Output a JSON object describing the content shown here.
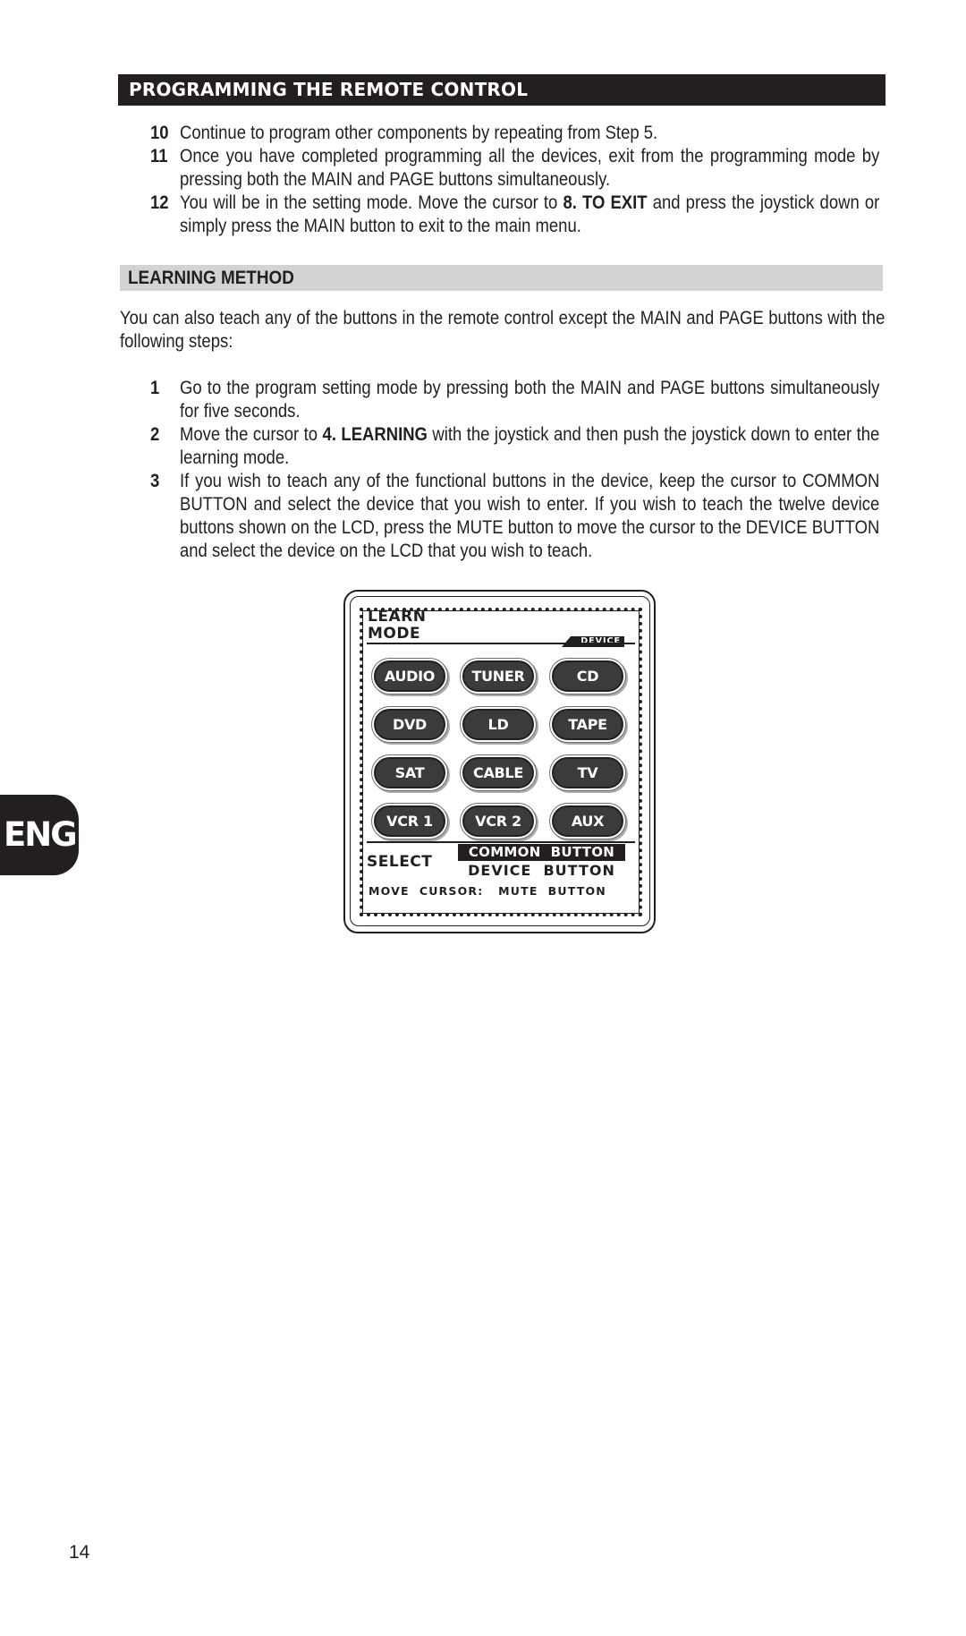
{
  "section": {
    "title": "PROGRAMMING THE REMOTE CONTROL",
    "steps": [
      {
        "num": "10",
        "text": "Continue to program other components by repeating from Step 5."
      },
      {
        "num": "11",
        "text": "Once you have completed programming all the devices, exit from the programming mode by pressing both the MAIN and PAGE buttons simultaneously."
      },
      {
        "num": "12",
        "text_before": "You will be in the setting mode. Move the cursor to ",
        "bold": "8. TO EXIT",
        "text_after": " and press the joystick down or simply press the MAIN button to exit to the main menu."
      }
    ]
  },
  "learning": {
    "title": "LEARNING METHOD",
    "intro": "You can also teach any of the buttons in the remote control except the MAIN and PAGE buttons with the following steps:",
    "steps": [
      {
        "num": "1",
        "text": "Go to the program setting mode by pressing both the MAIN and PAGE buttons simultaneously for five seconds."
      },
      {
        "num": "2",
        "text_before": "Move the cursor to ",
        "bold": "4. LEARNING",
        "text_after": " with the joystick and then push the joystick down to enter the learning mode."
      },
      {
        "num": "3",
        "text": "If you wish to teach any of the functional buttons in the device, keep the cursor to COMMON BUTTON and select the device that you wish to enter. If you wish to teach the twelve device buttons shown on the LCD, press the MUTE button to move the cursor to the DEVICE BUTTON and select the device on the LCD that you wish to teach."
      }
    ]
  },
  "lcd": {
    "title_line1": "LEARN",
    "title_line2": "MODE",
    "device_tag": "DEVICE",
    "buttons": [
      "AUDIO",
      "TUNER",
      "CD",
      "DVD",
      "LD",
      "TAPE",
      "SAT",
      "CABLE",
      "TV",
      "VCR 1",
      "VCR 2",
      "AUX"
    ],
    "select_label": "SELECT",
    "option_selected": "COMMON  BUTTON",
    "option_other": "DEVICE  BUTTON",
    "footer": "MOVE  CURSOR:   MUTE  BUTTON"
  },
  "language_tab": "ENG",
  "page_number": "14"
}
